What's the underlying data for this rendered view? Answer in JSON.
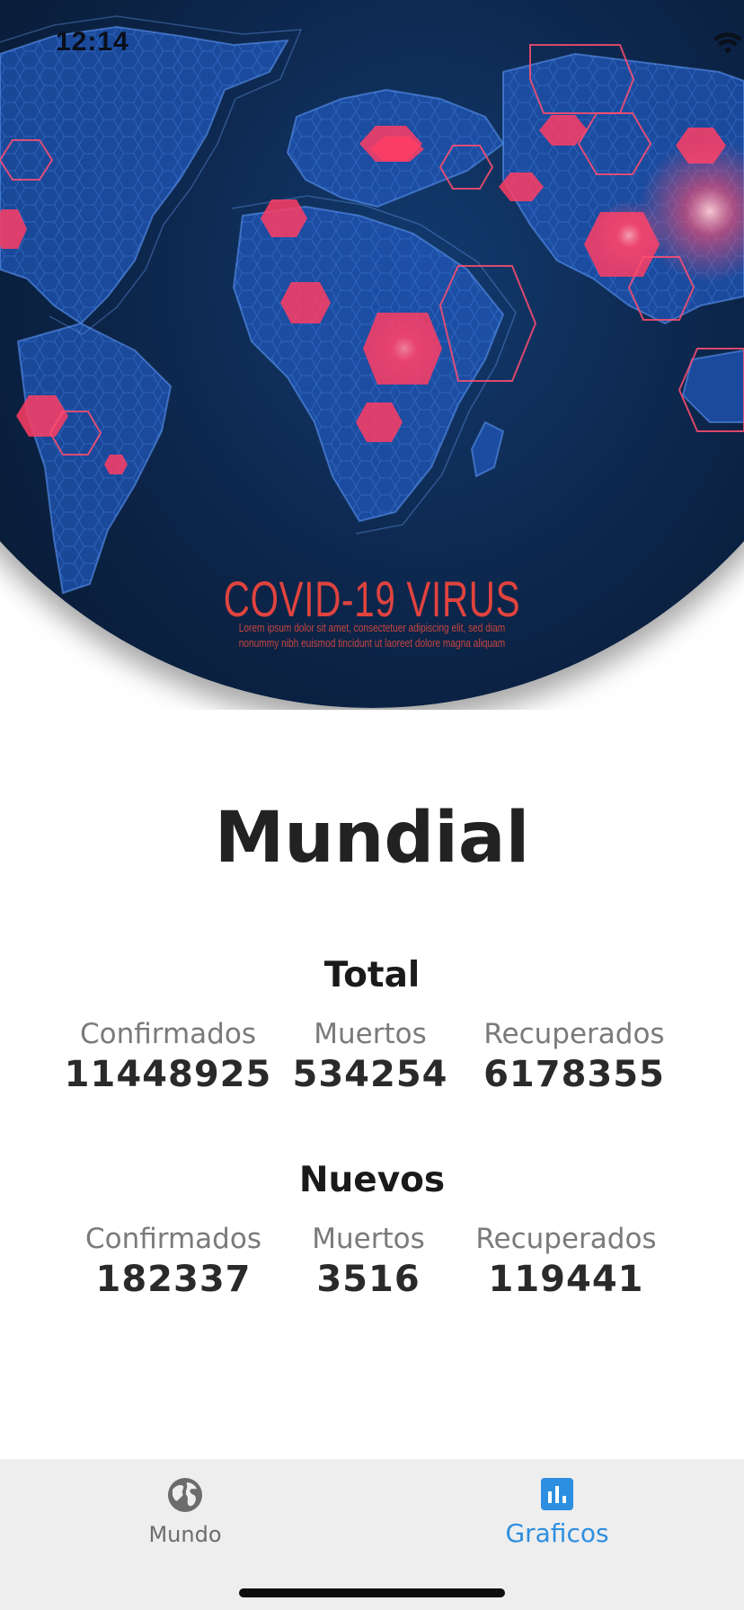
{
  "status_bar": {
    "time": "12:14",
    "icons": [
      "wifi-icon",
      "battery-icon"
    ]
  },
  "hero": {
    "title": "COVID-19 VIRUS",
    "subtitle_line1": "Lorem ipsum dolor sit amet, consectetuer adipiscing elit, sed diam",
    "subtitle_line2": "nonummy nibh euismod tincidunt ut laoreet dolore magna aliquam",
    "colors": {
      "background": "#0b2042",
      "map": "#2f6fd6",
      "hotspot": "#ff3d64",
      "title": "#e0433e"
    }
  },
  "page": {
    "title": "Mundial"
  },
  "total": {
    "title": "Total",
    "stats": [
      {
        "label": "Confirmados",
        "value": "11448925"
      },
      {
        "label": "Muertos",
        "value": "534254"
      },
      {
        "label": "Recuperados",
        "value": "6178355"
      }
    ]
  },
  "nuevos": {
    "title": "Nuevos",
    "stats": [
      {
        "label": "Confirmados",
        "value": "182337"
      },
      {
        "label": "Muertos",
        "value": "3516"
      },
      {
        "label": "Recuperados",
        "value": "119441"
      }
    ]
  },
  "tabbar": {
    "tabs": [
      {
        "label": "Mundo",
        "icon": "globe-icon",
        "active": false
      },
      {
        "label": "Graficos",
        "icon": "bar-chart-icon",
        "active": true
      }
    ],
    "colors": {
      "active": "#2d8fe0",
      "inactive": "#6c6c6c",
      "background": "#eeeeee"
    }
  }
}
